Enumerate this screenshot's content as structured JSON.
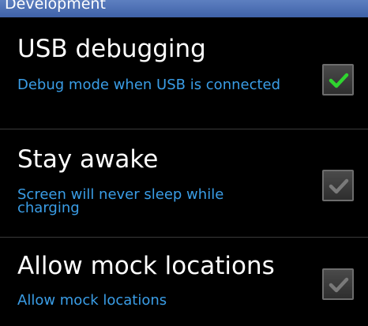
{
  "header": {
    "title": "Development"
  },
  "settings": [
    {
      "title": "USB debugging",
      "summary": "Debug mode when USB is connected",
      "checked": true,
      "enabled": true
    },
    {
      "title": "Stay awake",
      "summary": "Screen will never sleep while charging",
      "checked": true,
      "enabled": false
    },
    {
      "title": "Allow mock locations",
      "summary": "Allow mock locations",
      "checked": true,
      "enabled": false
    }
  ],
  "colors": {
    "header_bg": "#4a6db3",
    "summary_text": "#3a9de6",
    "check_active": "#2fd52f",
    "check_inactive": "#7a7a7a"
  },
  "icons": {
    "checkmark": "checkmark-icon"
  }
}
